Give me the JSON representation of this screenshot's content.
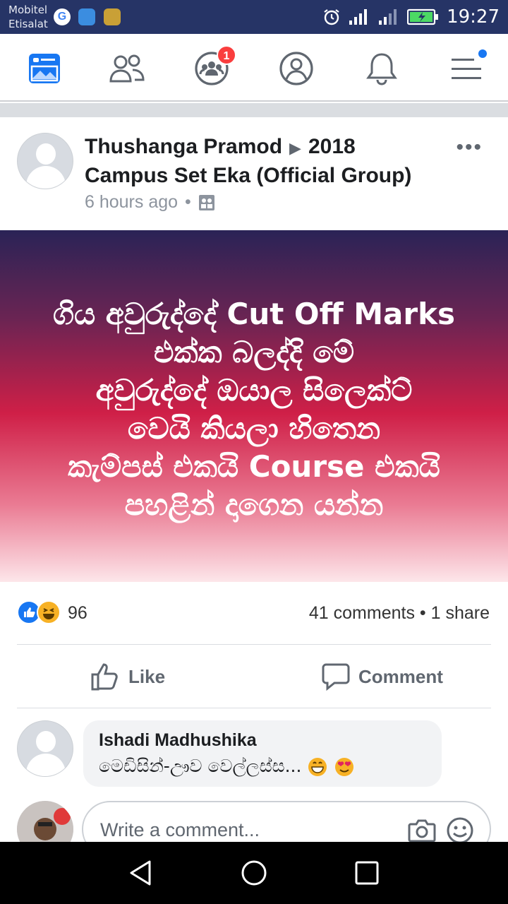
{
  "status_bar": {
    "carrier_line1": "Mobitel",
    "carrier_line2": "Etisalat",
    "time": "19:27"
  },
  "nav": {
    "groups_badge": "1",
    "items": [
      "news-feed",
      "friends",
      "groups",
      "profile",
      "notifications",
      "menu"
    ]
  },
  "post": {
    "author": "Thushanga Pramod",
    "group": "2018 Campus Set Eka (Official Group)",
    "time": "6 hours ago",
    "more": "•••",
    "text_lines": [
      "ගිය අවුරුද්දේ Cut Off Marks",
      "එක්ක බලද්දි මේ",
      "අවුරුද්දේ ඔයාල සිලෙක්ට්",
      "වෙයි කියලා හිතෙන",
      "කැම්පස් එකයි Course එකයි",
      "පහළින් දාගෙන යන්න"
    ],
    "reaction_count": "96",
    "comments": "41 comments",
    "shares": "1 share",
    "like_label": "Like",
    "comment_label": "Comment"
  },
  "comment": {
    "author": "Ishadi Madhushika",
    "text": "මෙඩිසින්-ඌව වෙල්ලස්ස..."
  },
  "composer": {
    "placeholder": "Write a comment..."
  },
  "colors": {
    "status_bar": "#263466",
    "brand_blue": "#1877f2",
    "badge_red": "#fa3e3e"
  }
}
